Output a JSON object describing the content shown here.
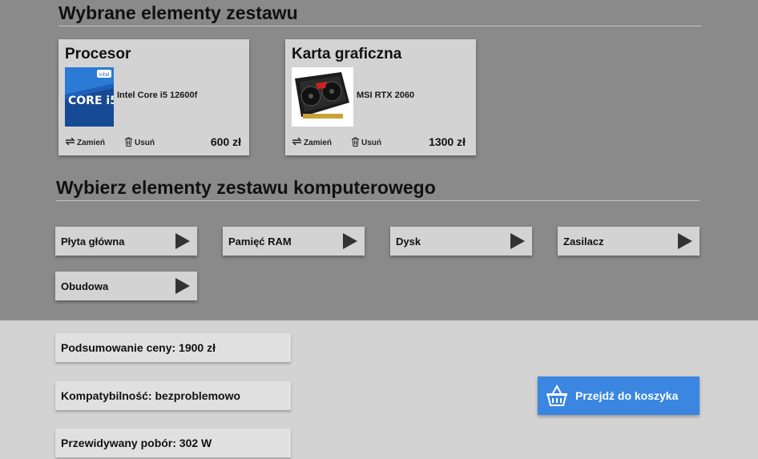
{
  "selected_section": {
    "title": "Wybrane elementy zestawu",
    "cards": [
      {
        "category": "Procesor",
        "product": "Intel Core i5 12600f",
        "swap_label": "Zamień",
        "remove_label": "Usuń",
        "price": "600 zł"
      },
      {
        "category": "Karta graficzna",
        "product": "MSI RTX 2060",
        "swap_label": "Zamień",
        "remove_label": "Usuń",
        "price": "1300 zł"
      }
    ],
    "box_badge": {
      "brand": "intel",
      "model": "CORE i5"
    }
  },
  "choose_section": {
    "title": "Wybierz elementy zestawu komputerowego",
    "items": [
      "Płyta główna",
      "Pamięć RAM",
      "Dysk",
      "Zasilacz",
      "Obudowa"
    ]
  },
  "summary": {
    "price": "Podsumowanie ceny: 1900 zł",
    "compatibility": "Kompatybilność: bezproblemowo",
    "power": "Przewidywany pobór: 302 W"
  },
  "cart_button": {
    "label": "Przejdź do koszyka",
    "color": "#3a86e0"
  }
}
